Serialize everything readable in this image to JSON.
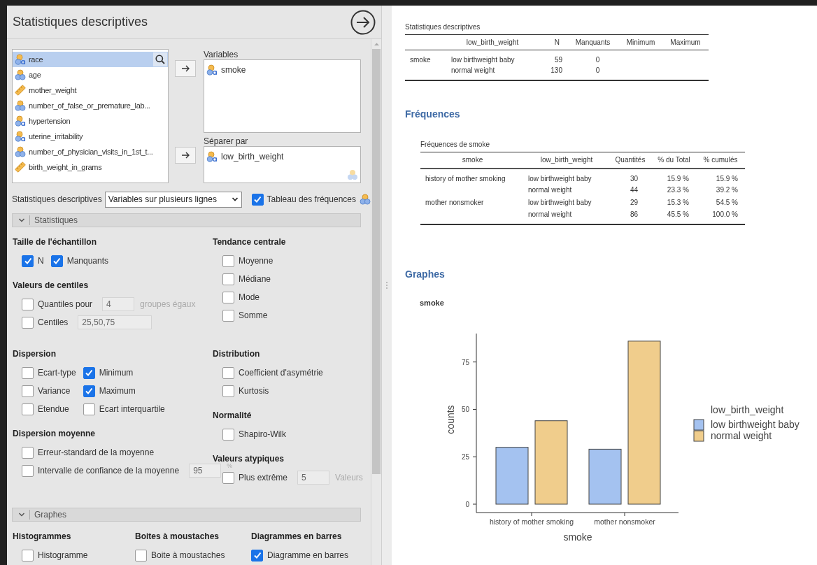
{
  "window": {
    "title": "Statistiques descriptives"
  },
  "variable_list": {
    "items": [
      {
        "name": "race",
        "kind": "nominal_text",
        "selected": true
      },
      {
        "name": "age",
        "kind": "nominal",
        "selected": false
      },
      {
        "name": "mother_weight",
        "kind": "continuous",
        "selected": false
      },
      {
        "name": "number_of_false_or_premature_lab...",
        "kind": "nominal",
        "selected": false
      },
      {
        "name": "hypertension",
        "kind": "nominal_text",
        "selected": false
      },
      {
        "name": "uterine_irritability",
        "kind": "nominal_text",
        "selected": false
      },
      {
        "name": "number_of_physician_visits_in_1st_t...",
        "kind": "nominal",
        "selected": false
      },
      {
        "name": "birth_weight_in_grams",
        "kind": "continuous",
        "selected": false
      }
    ]
  },
  "targets": [
    {
      "label": "Variables",
      "items": [
        {
          "name": "smoke",
          "kind": "nominal_text"
        }
      ]
    },
    {
      "label": "Séparer par",
      "items": [
        {
          "name": "low_birth_weight",
          "kind": "nominal_text"
        }
      ],
      "hint_icon": true
    }
  ],
  "layout_row": {
    "label": "Statistiques descriptives",
    "select_value": "Variables sur plusieurs lignes",
    "frequency_table": {
      "label": "Tableau des fréquences",
      "checked": true
    }
  },
  "sections": [
    {
      "kind": "two_column",
      "title": "Statistiques",
      "expanded": true,
      "blocks": [
        {
          "left": [
            {
              "title": "Taille de l'échantillon",
              "rows": [
                [
                  {
                    "kind": "checkbox",
                    "label": "N",
                    "checked": true
                  },
                  {
                    "kind": "checkbox",
                    "label": "Manquants",
                    "checked": true
                  }
                ]
              ]
            },
            {
              "title": "Valeurs de centiles",
              "rows": [
                [
                  {
                    "kind": "checkbox_field",
                    "label": "Quantiles pour",
                    "checked": false,
                    "value": "4",
                    "suffix": "groupes égaux"
                  }
                ],
                [
                  {
                    "kind": "checkbox_field",
                    "label": "Centiles",
                    "checked": false,
                    "value": "25,50,75",
                    "wide": true
                  }
                ]
              ]
            }
          ],
          "right": [
            {
              "title": "Tendance centrale",
              "rows": [
                [
                  {
                    "kind": "checkbox",
                    "label": "Moyenne",
                    "checked": false
                  }
                ],
                [
                  {
                    "kind": "checkbox",
                    "label": "Médiane",
                    "checked": false
                  }
                ],
                [
                  {
                    "kind": "checkbox",
                    "label": "Mode",
                    "checked": false
                  }
                ],
                [
                  {
                    "kind": "checkbox",
                    "label": "Somme",
                    "checked": false
                  }
                ]
              ]
            }
          ]
        },
        {
          "left": [
            {
              "title": "Dispersion",
              "rows": [
                [
                  {
                    "kind": "checkbox",
                    "label": "Ecart-type",
                    "checked": false
                  },
                  {
                    "kind": "checkbox",
                    "label": "Minimum",
                    "checked": true
                  }
                ],
                [
                  {
                    "kind": "checkbox",
                    "label": "Variance",
                    "checked": false
                  },
                  {
                    "kind": "checkbox",
                    "label": "Maximum",
                    "checked": true
                  }
                ],
                [
                  {
                    "kind": "checkbox",
                    "label": "Etendue",
                    "checked": false
                  },
                  {
                    "kind": "checkbox",
                    "label": "Ecart interquartile",
                    "checked": false
                  }
                ]
              ]
            },
            {
              "title": "Dispersion moyenne",
              "rows": [
                [
                  {
                    "kind": "checkbox",
                    "label": "Erreur-standard de la moyenne",
                    "checked": false
                  }
                ],
                [
                  {
                    "kind": "checkbox_field",
                    "label": "Intervalle de confiance de la moyenne",
                    "checked": false,
                    "value": "95",
                    "suffix": "%"
                  }
                ]
              ]
            }
          ],
          "right": [
            {
              "title": "Distribution",
              "rows": [
                [
                  {
                    "kind": "checkbox",
                    "label": "Coefficient d'asymétrie",
                    "checked": false
                  }
                ],
                [
                  {
                    "kind": "checkbox",
                    "label": "Kurtosis",
                    "checked": false
                  }
                ]
              ]
            },
            {
              "title": "Normalité",
              "rows": [
                [
                  {
                    "kind": "checkbox",
                    "label": "Shapiro-Wilk",
                    "checked": false
                  }
                ]
              ]
            },
            {
              "title": "Valeurs atypiques",
              "rows": [
                [
                  {
                    "kind": "checkbox_field",
                    "label": "Plus extrême",
                    "checked": false,
                    "value": "5",
                    "suffix": "Valeurs"
                  }
                ]
              ]
            }
          ]
        }
      ]
    },
    {
      "kind": "three_column",
      "title": "Graphes",
      "expanded": true,
      "columns": [
        {
          "title": "Histogrammes",
          "rows": [
            [
              {
                "kind": "checkbox",
                "label": "Histogramme",
                "checked": false
              }
            ]
          ]
        },
        {
          "title": "Boites à moustaches",
          "rows": [
            [
              {
                "kind": "checkbox",
                "label": "Boite à moustaches",
                "checked": false
              }
            ]
          ]
        },
        {
          "title": "Diagrammes en barres",
          "rows": [
            [
              {
                "kind": "checkbox",
                "label": "Diagramme en barres",
                "checked": true
              }
            ]
          ]
        }
      ]
    }
  ],
  "results": {
    "descriptives": {
      "title": "Statistiques descriptives",
      "columns": [
        "",
        "low_birth_weight",
        "N",
        "Manquants",
        "Minimum",
        "Maximum"
      ],
      "rows": [
        {
          "cells": [
            "smoke",
            "low birthweight baby",
            "59",
            "0"
          ]
        },
        {
          "cells": [
            "",
            "normal weight",
            "130",
            "0"
          ]
        }
      ]
    },
    "frequencies": {
      "heading": "Fréquences",
      "title": "Fréquences de smoke",
      "columns": [
        "smoke",
        "low_birth_weight",
        "Quantités",
        "% du Total",
        "% cumulés"
      ],
      "rows": [
        {
          "cells": [
            "history of mother smoking",
            "low birthweight baby",
            "30",
            "15.9 %",
            "15.9 %"
          ]
        },
        {
          "cells": [
            "",
            "normal weight",
            "44",
            "23.3 %",
            "39.2 %"
          ]
        },
        {
          "cells": [
            "mother nonsmoker",
            "low birthweight baby",
            "29",
            "15.3 %",
            "54.5 %"
          ]
        },
        {
          "cells": [
            "",
            "normal weight",
            "86",
            "45.5 %",
            "100.0 %"
          ]
        }
      ]
    },
    "graphs": {
      "heading": "Graphes",
      "title": "smoke",
      "chart_data": {
        "type": "bar",
        "xlabel": "smoke",
        "ylabel": "counts",
        "legend": {
          "title": "low_birth_weight"
        },
        "categories": [
          "history of mother smoking",
          "mother nonsmoker"
        ],
        "series": [
          {
            "name": "low birthweight baby",
            "color": "#a4c2f0",
            "values": [
              30,
              29
            ]
          },
          {
            "name": "normal weight",
            "color": "#f0cd8c",
            "values": [
              44,
              86
            ]
          }
        ],
        "ylim": [
          0,
          90
        ],
        "yticks": [
          0,
          25,
          50,
          75
        ]
      }
    }
  }
}
